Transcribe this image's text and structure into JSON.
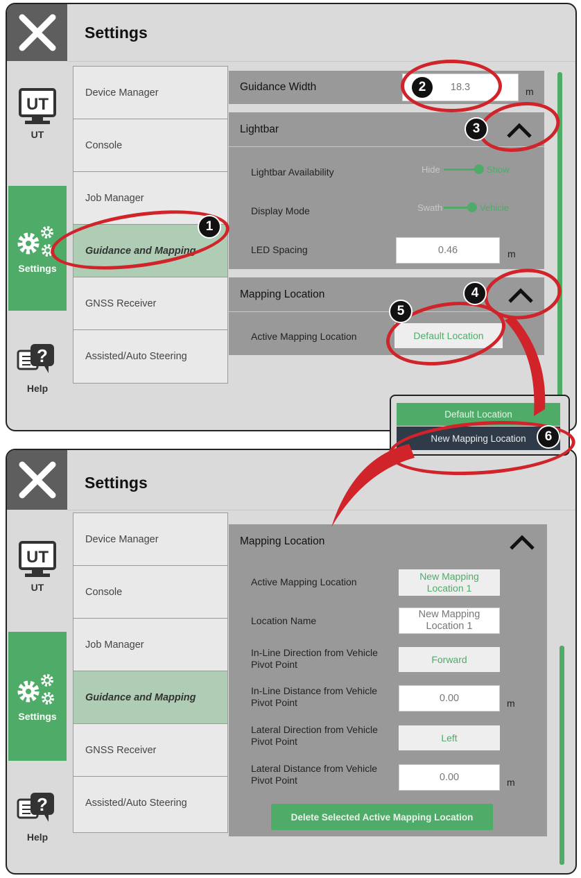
{
  "top": {
    "title": "Settings",
    "nav": {
      "ut": "UT",
      "ut_icon_text": "UT",
      "settings": "Settings",
      "help": "Help"
    },
    "menu": [
      "Device Manager",
      "Console",
      "Job Manager",
      "Guidance and Mapping",
      "GNSS Receiver",
      "Assisted/Auto Steering"
    ],
    "guidance_width": {
      "label": "Guidance Width",
      "value": "18.3",
      "unit": "m"
    },
    "lightbar": {
      "title": "Lightbar",
      "availability_label": "Lightbar Availability",
      "availability_off": "Hide",
      "availability_on": "Show",
      "display_label": "Display Mode",
      "display_off": "Swath",
      "display_on": "Vehicle",
      "led_label": "LED Spacing",
      "led_value": "0.46",
      "led_unit": "m"
    },
    "mapping": {
      "title": "Mapping Location",
      "active_label": "Active Mapping Location",
      "active_value": "Default Location"
    },
    "dropdown": [
      "Default Location",
      "New Mapping Location"
    ]
  },
  "bottom": {
    "title": "Settings",
    "nav": {
      "ut": "UT",
      "ut_icon_text": "UT",
      "settings": "Settings",
      "help": "Help"
    },
    "menu": [
      "Device Manager",
      "Console",
      "Job Manager",
      "Guidance and Mapping",
      "GNSS Receiver",
      "Assisted/Auto Steering"
    ],
    "mapping": {
      "title": "Mapping Location",
      "active_label": "Active Mapping Location",
      "active_value": "New Mapping Location 1",
      "name_label": "Location Name",
      "name_value": "New Mapping Location 1",
      "inline_dir_label": "In-Line Direction from Vehicle Pivot Point",
      "inline_dir_value": "Forward",
      "inline_dist_label": "In-Line Distance from Vehicle Pivot Point",
      "inline_dist_value": "0.00",
      "inline_dist_unit": "m",
      "lat_dir_label": "Lateral Direction from Vehicle Pivot Point",
      "lat_dir_value": "Left",
      "lat_dist_label": "Lateral Distance from Vehicle Pivot Point",
      "lat_dist_value": "0.00",
      "lat_dist_unit": "m",
      "delete_label": "Delete Selected Active Mapping Location"
    }
  },
  "callouts": [
    "1",
    "2",
    "3",
    "4",
    "5",
    "6"
  ],
  "colors": {
    "accent": "#4fab68",
    "callout": "#d0232a",
    "panel": "#999999",
    "background": "#dadada"
  }
}
